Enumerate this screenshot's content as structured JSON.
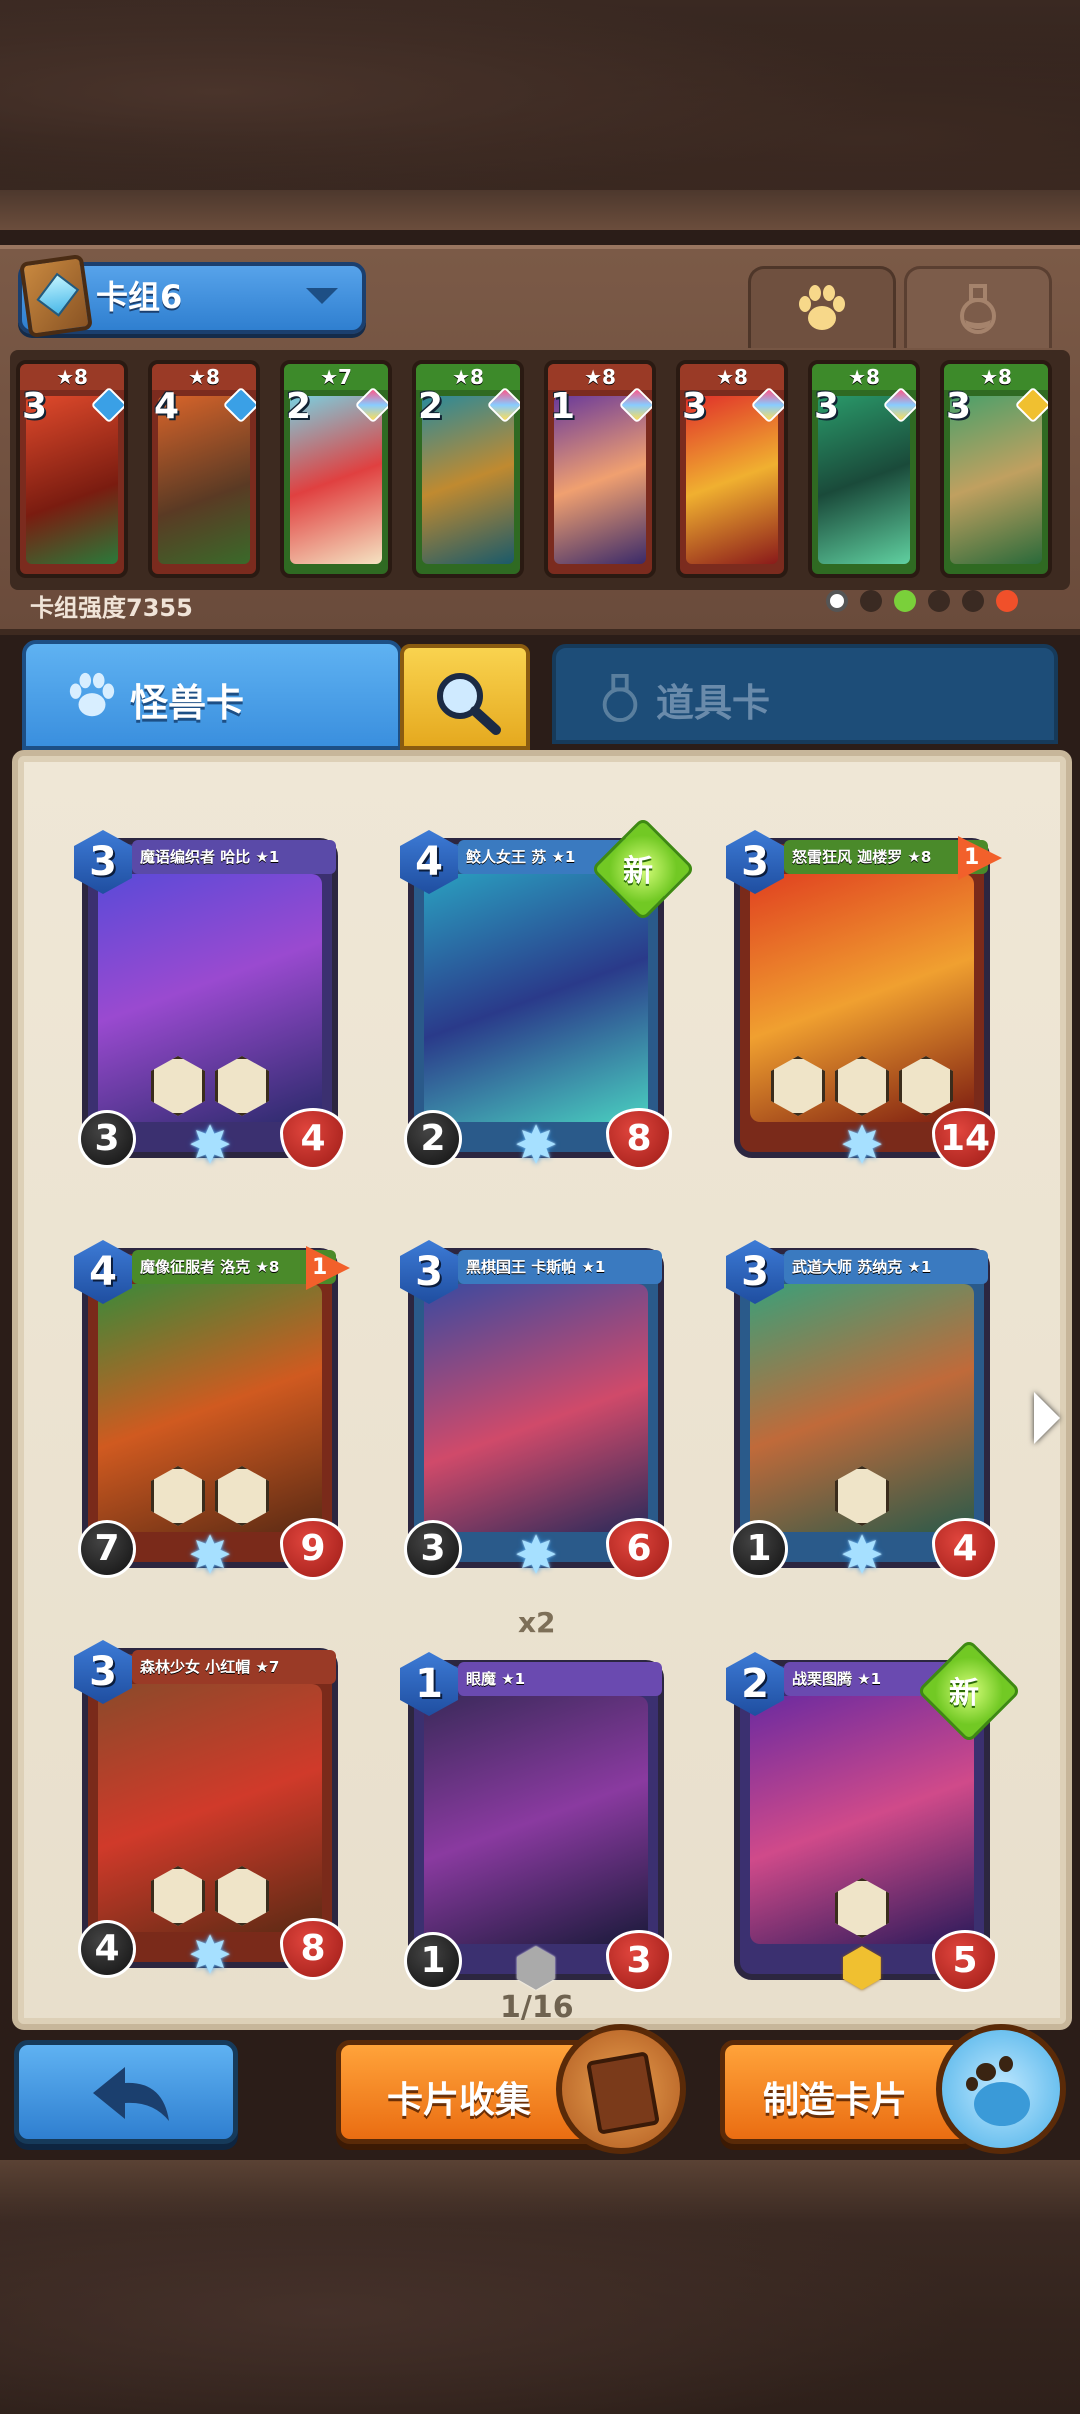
{
  "header": {
    "deck_name": "卡组6",
    "deck_power": "卡组强度7355"
  },
  "deck_cards": [
    {
      "cost": "3",
      "stars": "★8",
      "theme": "red"
    },
    {
      "cost": "4",
      "stars": "★8",
      "theme": "red"
    },
    {
      "cost": "2",
      "stars": "★7",
      "theme": "green"
    },
    {
      "cost": "2",
      "stars": "★8",
      "theme": "green"
    },
    {
      "cost": "1",
      "stars": "★8",
      "theme": "red"
    },
    {
      "cost": "3",
      "stars": "★8",
      "theme": "red"
    },
    {
      "cost": "3",
      "stars": "★8",
      "theme": "green"
    },
    {
      "cost": "3",
      "stars": "★8",
      "theme": "green"
    }
  ],
  "tabs": {
    "monster_label": "怪兽卡",
    "item_label": "道具卡"
  },
  "cards": [
    {
      "title": "魔语编织者 哈比 ★1",
      "cost": "3",
      "attack": "3",
      "health": "4",
      "is_new": false,
      "flag": ""
    },
    {
      "title": "鲛人女王 苏 ★1",
      "cost": "4",
      "attack": "2",
      "health": "8",
      "is_new": true,
      "flag": ""
    },
    {
      "title": "怒雷狂风 迦楼罗 ★8",
      "cost": "3",
      "attack": "",
      "health": "14",
      "is_new": false,
      "flag": "1"
    },
    {
      "title": "魔像征服者 洛克 ★8",
      "cost": "4",
      "attack": "7",
      "health": "9",
      "is_new": false,
      "flag": "1"
    },
    {
      "title": "黑棋国王 卡斯帕 ★1",
      "cost": "3",
      "attack": "3",
      "health": "6",
      "is_new": false,
      "flag": ""
    },
    {
      "title": "武道大师 苏纳克 ★1",
      "cost": "3",
      "attack": "1",
      "health": "4",
      "is_new": false,
      "flag": ""
    },
    {
      "title": "森林少女 小红帽 ★7",
      "cost": "3",
      "attack": "4",
      "health": "8",
      "is_new": false,
      "flag": ""
    },
    {
      "title": "眼魔 ★1",
      "cost": "1",
      "attack": "1",
      "health": "3",
      "is_new": false,
      "flag": ""
    },
    {
      "title": "战栗图腾 ★1",
      "cost": "2",
      "attack": "",
      "health": "5",
      "is_new": true,
      "flag": ""
    }
  ],
  "new_label": "新",
  "duplicate_count": "x2",
  "pagination": "1/16",
  "buttons": {
    "collection": "卡片收集",
    "craft": "制造卡片"
  }
}
